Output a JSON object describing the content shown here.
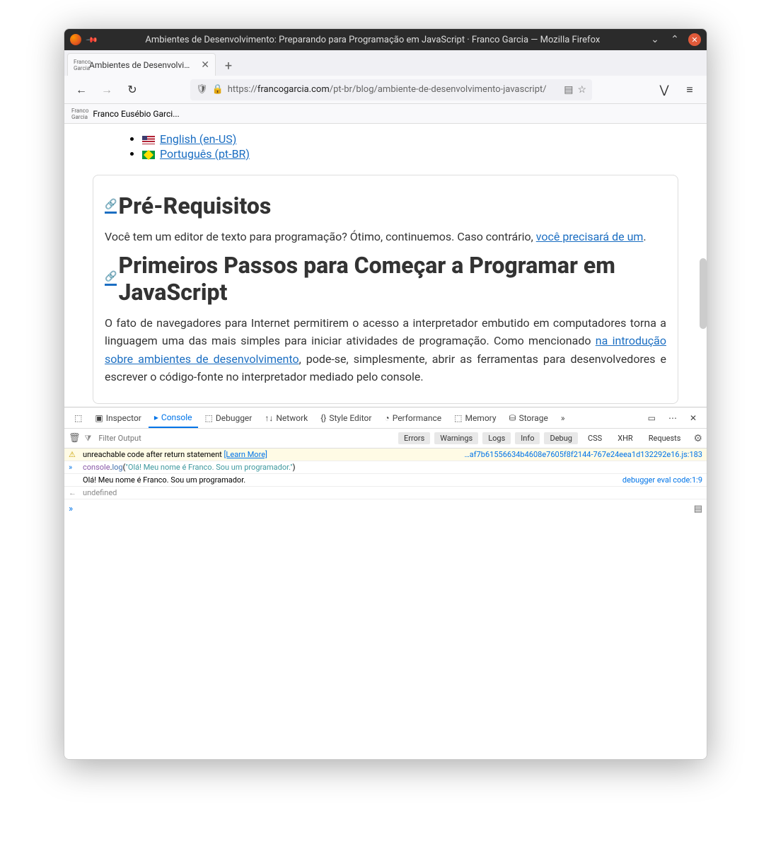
{
  "window_title": "Ambientes de Desenvolvimento: Preparando para Programação em JavaScript · Franco Garcia — Mozilla Firefox",
  "tab": {
    "title": "Ambientes de Desenvolvimen"
  },
  "url": {
    "prefix": "https://",
    "domain": "francogarcia.com",
    "path": "/pt-br/blog/ambiente-de-desenvolvimento-javascript/"
  },
  "bookmark": {
    "title": "Franco Eusébio Garci..."
  },
  "languages": [
    {
      "flag": "us",
      "text": "English (en-US)"
    },
    {
      "flag": "br",
      "text": "Português (pt-BR)"
    }
  ],
  "page": {
    "h_prereq": "Pré-Requisitos",
    "p_prereq_1": "Você tem um editor de texto para programação? Ótimo, continuemos. Caso contrário, ",
    "p_prereq_link": "você precisará de um",
    "h_steps": "Primeiros Passos para Começar a Programar em JavaScript",
    "p_steps_1": "O fato de navegadores para Internet permitirem o acesso a interpretador embutido em computadores torna a linguagem uma das mais simples para iniciar atividades de programação. Como mencionado ",
    "p_steps_link": "na introdução sobre ambientes de desenvolvimento",
    "p_steps_2": ", pode-se, simplesmente, abrir as ferramentas para desenvolvedores e escrever o código-fonte no interpretador mediado pelo console."
  },
  "devtools": {
    "tabs": {
      "inspector": "Inspector",
      "console": "Console",
      "debugger": "Debugger",
      "network": "Network",
      "style_editor": "Style Editor",
      "performance": "Performance",
      "memory": "Memory",
      "storage": "Storage"
    },
    "filter_placeholder": "Filter Output",
    "pills": {
      "errors": "Errors",
      "warnings": "Warnings",
      "logs": "Logs",
      "info": "Info",
      "debug": "Debug",
      "css": "CSS",
      "xhr": "XHR",
      "requests": "Requests"
    },
    "warning_msg": "unreachable code after return statement",
    "warning_learn": "[Learn More]",
    "warning_src": "…af7b61556634b4608e7605f8f2144-767e24eea1d132292e16.js:183",
    "input_code": {
      "obj": "console",
      "method": "log",
      "arg": "\"Olá! Meu nome é Franco. Sou um programador.\""
    },
    "output_text": "Olá! Meu nome é Franco. Sou um programador.",
    "output_src": "debugger eval code:1:9",
    "undefined": "undefined"
  }
}
